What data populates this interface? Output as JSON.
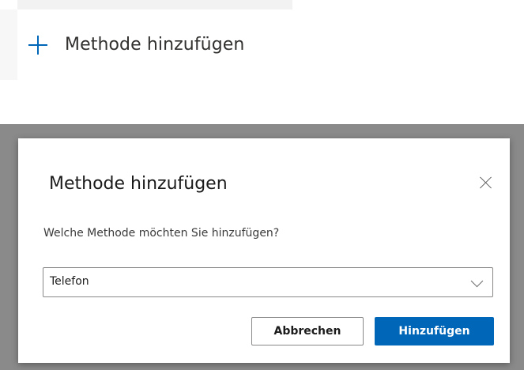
{
  "add_method": {
    "label": "Methode hinzufügen",
    "icon": "plus-icon",
    "accent_color": "#0067b8"
  },
  "dialog": {
    "title": "Methode hinzufügen",
    "close_icon": "close-icon",
    "question": "Welche Methode möchten Sie hinzufügen?",
    "select": {
      "selected_value": "Telefon",
      "icon": "chevron-down-icon"
    },
    "buttons": {
      "cancel_label": "Abbrechen",
      "add_label": "Hinzufügen"
    },
    "primary_color": "#0067b8"
  }
}
